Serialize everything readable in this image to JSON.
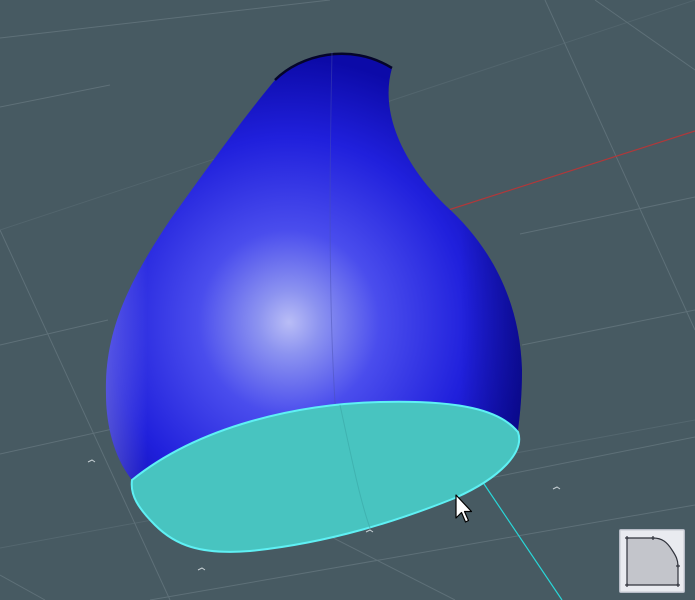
{
  "viewport": {
    "background": "#475a62",
    "grid_color": "#5e7078",
    "x_axis_color": "#b0383a",
    "y_axis_color": "#29d7d8",
    "body_color": "#2626e6",
    "selected_face_color": "#48c4c0",
    "selected_edge_color": "#5ff0f4"
  },
  "icons": {
    "cursor": "arrow-cursor-icon",
    "tool": "fillet-corner-icon"
  }
}
